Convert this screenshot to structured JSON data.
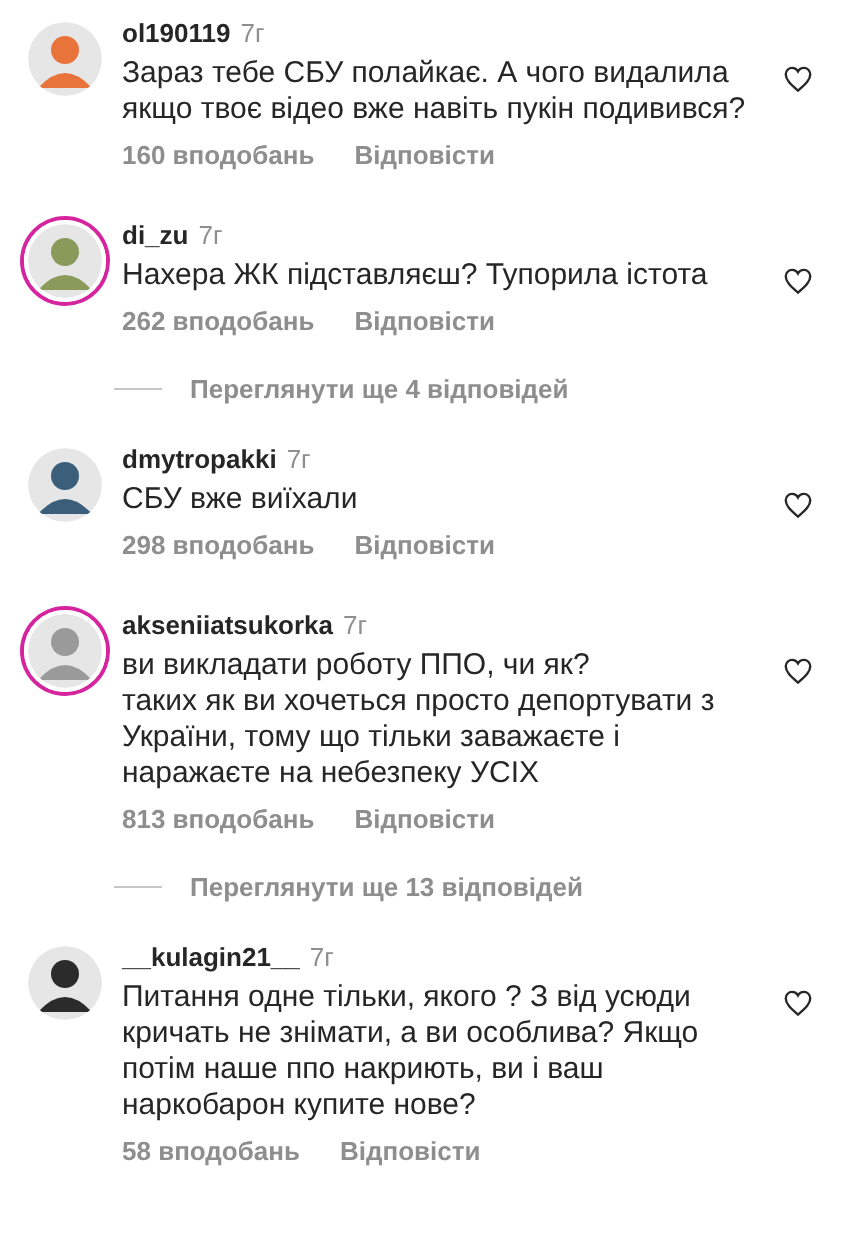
{
  "items": [
    {
      "kind": "comment",
      "username": "ol190119",
      "time": "7г",
      "text": "Зараз тебе СБУ полайкає. А чого видалила\nякщо твоє відео вже навіть пукін подивився?",
      "likes": "160 вподобань",
      "reply": "Відповісти",
      "story_ring": false,
      "liked": false,
      "color": "#e8743b"
    },
    {
      "kind": "comment",
      "username": "di_zu",
      "time": "7г",
      "text": "Нахера ЖК підставляєш? Тупорила істота",
      "likes": "262 вподобань",
      "reply": "Відповісти",
      "story_ring": true,
      "liked": false,
      "color": "#8a9a5b"
    },
    {
      "kind": "thread",
      "label": "Переглянути ще 4 відповідей"
    },
    {
      "kind": "comment",
      "username": "dmytropakki",
      "time": "7г",
      "text": "СБУ вже виїхали",
      "likes": "298 вподобань",
      "reply": "Відповісти",
      "story_ring": false,
      "liked": false,
      "color": "#3b5f7a"
    },
    {
      "kind": "comment",
      "username": "akseniiatsukorka",
      "time": "7г",
      "text": "ви викладати роботу ППО, чи як?\nтаких як ви хочеться просто депортувати з\nУкраїни, тому що тільки заважаєте і\nнаражаєте на небезпеку УСІХ",
      "likes": "813 вподобань",
      "reply": "Відповісти",
      "story_ring": true,
      "liked": false,
      "color": "#9a9a9a"
    },
    {
      "kind": "thread",
      "label": "Переглянути ще 13 відповідей"
    },
    {
      "kind": "comment",
      "username": "__kulagin21__",
      "time": "7г",
      "text": "Питання одне тільки, якого ? З від усюди\nкричать не знімати, а ви особлива? Якщо\nпотім наше ппо накриють, ви і ваш\nнаркобарон купите нове?",
      "likes": "58 вподобань",
      "reply": "Відповісти",
      "story_ring": false,
      "liked": false,
      "color": "#2b2b2b"
    }
  ]
}
